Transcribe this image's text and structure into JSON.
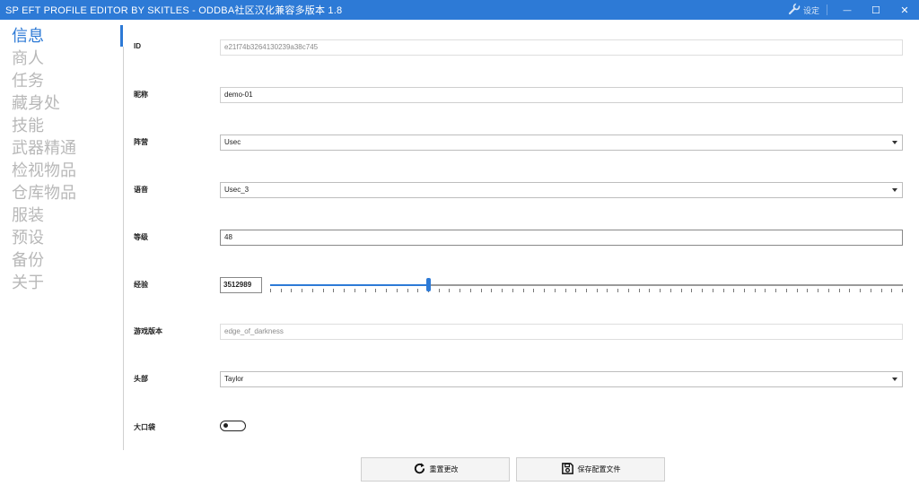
{
  "window": {
    "title": "SP EFT PROFILE EDITOR BY SKITLES - ODDBA社区汉化兼容多版本 1.8",
    "settings_label": "设定",
    "minimize_glyph": "—",
    "maximize_glyph": "☐",
    "close_glyph": "✕"
  },
  "sidebar": {
    "items": [
      {
        "label": "信息",
        "active": true
      },
      {
        "label": "商人"
      },
      {
        "label": "任务"
      },
      {
        "label": "藏身处"
      },
      {
        "label": "技能"
      },
      {
        "label": "武器精通"
      },
      {
        "label": "检视物品"
      },
      {
        "label": "仓库物品"
      },
      {
        "label": "服装"
      },
      {
        "label": "预设"
      },
      {
        "label": "备份"
      },
      {
        "label": "关于"
      }
    ]
  },
  "form": {
    "id": {
      "label": "ID",
      "value": "e21f74b3264130239a38c745"
    },
    "nickname": {
      "label": "昵称",
      "value": "demo-01"
    },
    "side": {
      "label": "阵营",
      "value": "Usec"
    },
    "voice": {
      "label": "语音",
      "value": "Usec_3"
    },
    "level": {
      "label": "等级",
      "value": "48"
    },
    "experience": {
      "label": "经验",
      "value": "3512989",
      "slider_fraction": 0.25
    },
    "game_version": {
      "label": "游戏版本",
      "value": "edge_of_darkness"
    },
    "head": {
      "label": "头部",
      "value": "Taylor"
    },
    "pockets": {
      "label": "大口袋",
      "checked": false
    }
  },
  "actions": {
    "reset_label": "重置更改",
    "save_label": "保存配置文件"
  },
  "colors": {
    "accent": "#2d7ad6",
    "inactive_nav": "#b8b8b8"
  },
  "icons": {
    "settings": "wrench-icon",
    "reset": "reload-icon",
    "save": "save-icon"
  }
}
